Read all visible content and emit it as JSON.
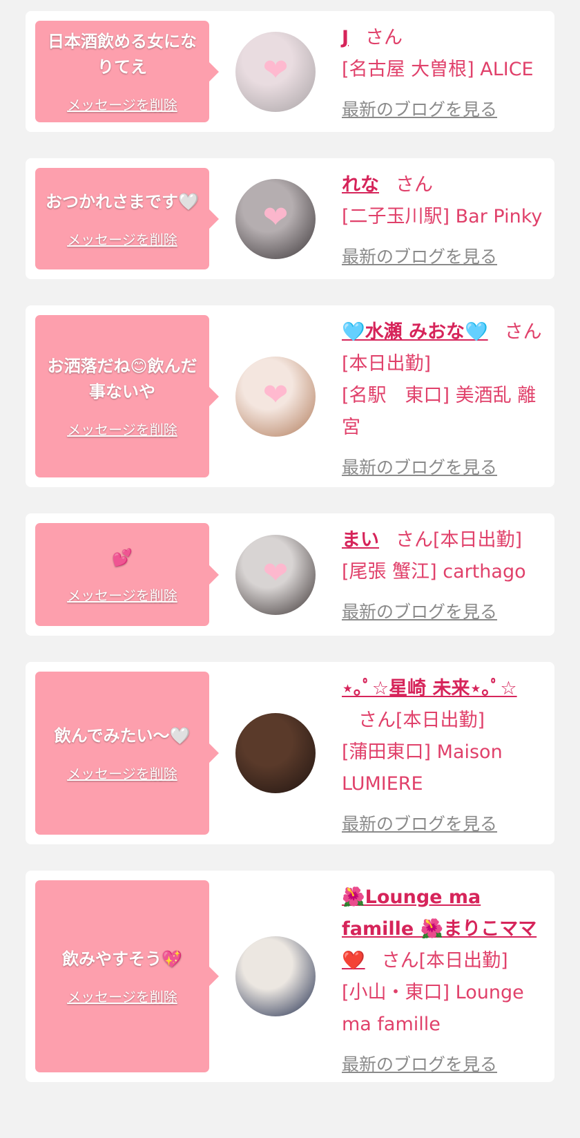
{
  "delete_label": "メッセージを削除",
  "blog_label": "最新のブログを見る",
  "colors": {
    "page_bg": "#f2f2f2",
    "card_bg": "#ffffff",
    "bubble_pink": "#fd9fad",
    "name_pink": "#d6245a",
    "text_pink": "#e0406a",
    "link_gray": "#8a8a8a"
  },
  "cards": [
    {
      "message": "日本酒飲める女になりてえ",
      "name": "J",
      "suffix": "さん",
      "store": "[名古屋 大曽根] ALICE",
      "avatar_colors": [
        "#e9dce0",
        "#a7a2a4"
      ],
      "avatar_icon": "pink-ribbon-heart-icon"
    },
    {
      "message": "おつかれさまです🤍",
      "name": "れな",
      "suffix": "さん",
      "store": "[二子玉川駅] Bar Pinky",
      "avatar_colors": [
        "#b5aeb0",
        "#3a3537"
      ],
      "avatar_icon": "pink-heart-icon"
    },
    {
      "message": "お洒落だね😊飲んだ事ないや",
      "name": "🩵水瀬 みおな🩵",
      "suffix": "さん[本日出勤]",
      "store": "[名駅　東口] 美酒乱 離宮",
      "avatar_colors": [
        "#f4e6df",
        "#b07a59"
      ],
      "avatar_icon": "pink-heart-icon"
    },
    {
      "message": "💕",
      "name": "まい",
      "suffix": "さん[本日出勤]",
      "store": "[尾張 蟹江] carthago",
      "avatar_colors": [
        "#d8d4d3",
        "#3a3232"
      ],
      "avatar_icon": "pink-heart-icon"
    },
    {
      "message": "飲んでみたい〜🤍",
      "name": "⋆｡ﾟ☆星崎 未来⋆｡ﾟ☆",
      "suffix": "さん[本日出勤]",
      "store": "[蒲田東口] Maison LUMIERE",
      "avatar_colors": [
        "#5a3a2a",
        "#1f1411"
      ],
      "avatar_icon": "photo-icon"
    },
    {
      "message": "飲みやすそう💖",
      "name": "🌺Lounge ma famille 🌺まりこママ❤️",
      "suffix": "さん[本日出勤]",
      "store": "[小山・東口] Lounge ma famille",
      "avatar_colors": [
        "#ece7e1",
        "#1e2a4c"
      ],
      "avatar_icon": "photo-icon"
    }
  ]
}
